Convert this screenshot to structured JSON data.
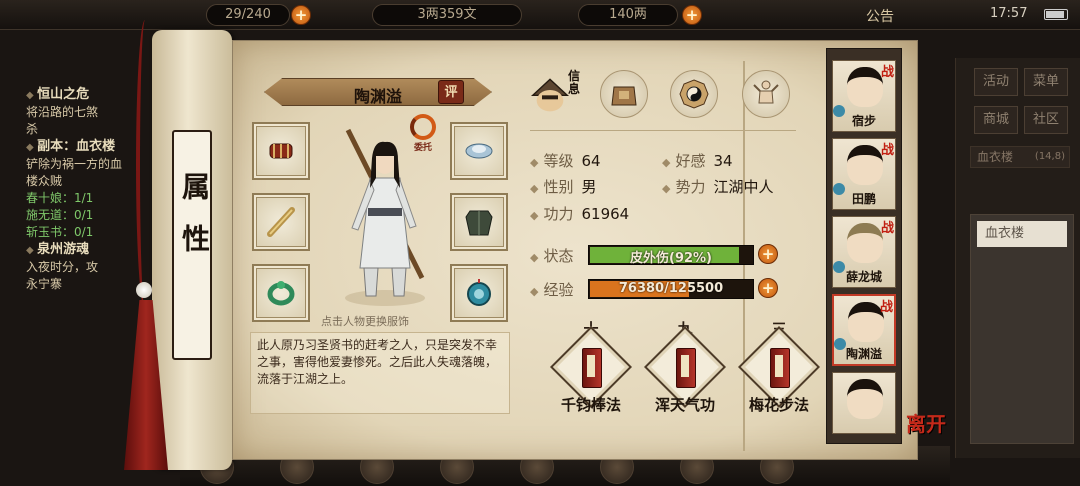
{
  "topbar": {
    "storage": "29/240",
    "money_wen": "3两359文",
    "money_liang": "140两",
    "announce": "公告",
    "clock": "17:57"
  },
  "quests": [
    {
      "title": "恒山之危",
      "lines": [
        "将沿路的七煞",
        "杀"
      ]
    },
    {
      "title": "副本：血衣楼",
      "lines": [
        "铲除为祸一方的血",
        "楼众贼"
      ],
      "progress": [
        "春十娘：1/1",
        "施无道：0/1",
        "斩玉书：0/1"
      ]
    },
    {
      "title": "泉州游魂",
      "lines": [
        "入夜时分，攻",
        "永宁寨"
      ]
    }
  ],
  "right_panel": {
    "buttons": [
      "活动",
      "菜单",
      "商城",
      "社区"
    ],
    "location": "血衣楼",
    "location_coords": "(14,8)",
    "list_item": "血衣楼"
  },
  "scroll": {
    "label": "属性"
  },
  "character": {
    "name": "陶渊溢",
    "eval_label": "评",
    "entrust_label": "委托",
    "change_outfit_hint": "点击人物更换服饰",
    "bio": "此人原乃习圣贤书的赶考之人，只是突发不幸之事，害得他爱妻惨死。之后此人失魂落魄，流落于江湖之上。"
  },
  "tabs": {
    "info_label": "信息"
  },
  "stats": {
    "level_label": "等级",
    "level": "64",
    "favor_label": "好感",
    "favor": "34",
    "gender_label": "性别",
    "gender": "男",
    "faction_label": "势力",
    "faction": "江湖中人",
    "power_label": "功力",
    "power": "61964",
    "status_label": "状态",
    "status_text": "皮外伤(92%)",
    "status_fraction": 0.92,
    "exp_label": "经验",
    "exp_text": "76380/125500",
    "exp_fraction": 0.6086
  },
  "skills": [
    {
      "level": "十",
      "name": "千钧棒法"
    },
    {
      "level": "九",
      "name": "浑天气功"
    },
    {
      "level": "三",
      "name": "梅花步法"
    }
  ],
  "party": [
    {
      "name": "宿步",
      "battle": "战"
    },
    {
      "name": "田鹏",
      "battle": "战"
    },
    {
      "name": "薛龙城",
      "battle": "战"
    },
    {
      "name": "陶渊溢",
      "battle": "战"
    },
    {
      "name": "",
      "battle": ""
    }
  ],
  "leave_label": "离开",
  "colors": {
    "status_bar": "#6fb23a",
    "exp_bar": "#d9741e",
    "accent_red": "#c4291a"
  }
}
